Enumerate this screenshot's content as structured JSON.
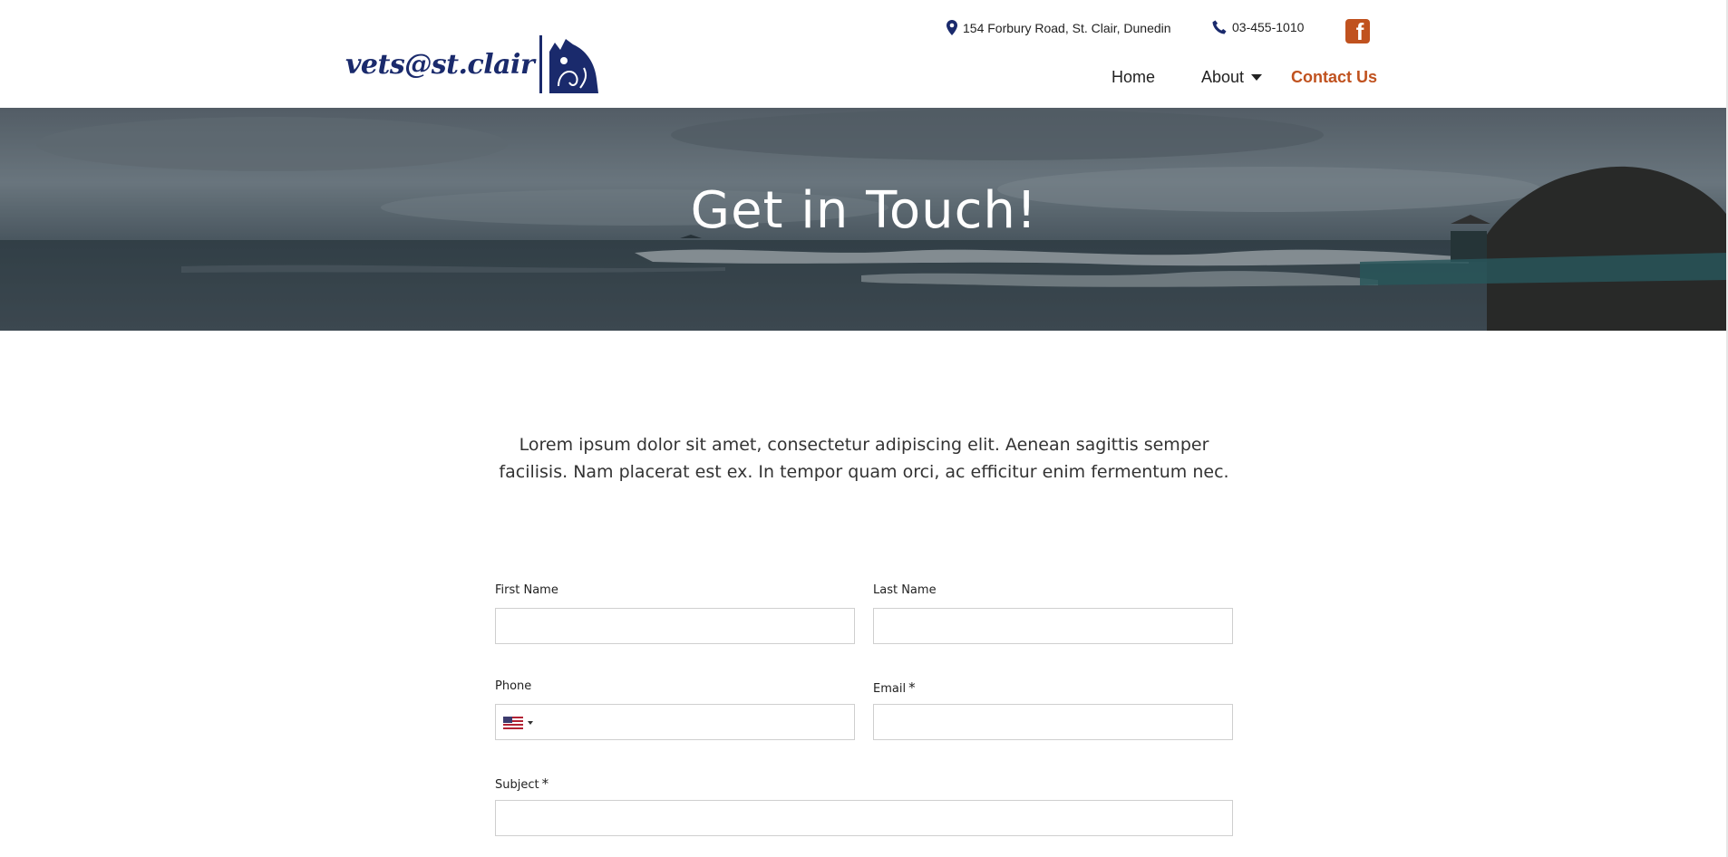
{
  "header": {
    "logo_text": "vets@st.clair",
    "address": "154 Forbury Road, St. Clair, Dunedin",
    "phone": "03-455-1010",
    "facebook_glyph": "f",
    "nav": {
      "home": "Home",
      "about": "About",
      "contact": "Contact Us"
    }
  },
  "hero": {
    "title": "Get in Touch!"
  },
  "intro": "Lorem ipsum dolor sit amet, consectetur adipiscing elit. Aenean sagittis semper facilisis. Nam placerat est ex. In tempor quam orci, ac efficitur enim fermentum nec.",
  "form": {
    "first_name_label": "First Name",
    "last_name_label": "Last Name",
    "phone_label": "Phone",
    "email_label": "Email",
    "subject_label": "Subject",
    "required_mark": "*",
    "first_name_value": "",
    "last_name_value": "",
    "phone_value": "",
    "email_value": "",
    "subject_value": ""
  },
  "colors": {
    "brand_navy": "#1a2a6c",
    "accent_orange": "#c0521f"
  },
  "icons": {
    "address": "map-pin-icon",
    "phone": "phone-icon",
    "social": "facebook-icon",
    "flag": "us-flag-icon"
  }
}
